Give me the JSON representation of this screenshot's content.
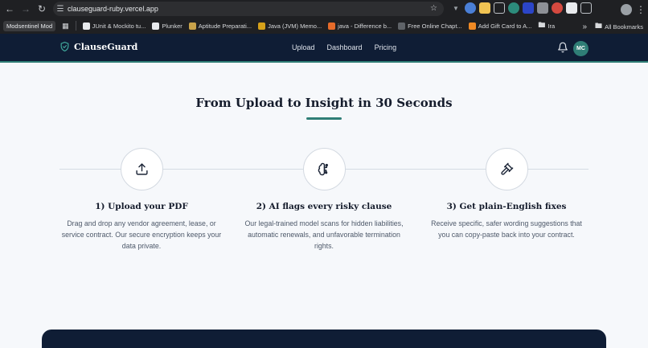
{
  "browser": {
    "url": "clauseguard-ruby.vercel.app",
    "bookmarks": [
      {
        "label": "Modsentinel Mod",
        "color": "#3a3b3e"
      },
      {
        "label": "JUnit & Mockito tu...",
        "color": "#e8eaed"
      },
      {
        "label": "Plunker",
        "color": "#e8eaed"
      },
      {
        "label": "Aptitude Preparati...",
        "color": "#c8a24a"
      },
      {
        "label": "Java (JVM) Memo...",
        "color": "#d6a11a"
      },
      {
        "label": "java - Difference b...",
        "color": "#e66b2a"
      },
      {
        "label": "Free Online Chapt...",
        "color": "#5f6368"
      },
      {
        "label": "Add Gift Card to A...",
        "color": "#f08a24"
      },
      {
        "label": "Ira",
        "color": "#9aa0a6"
      }
    ],
    "all_bookmarks": "All Bookmarks",
    "overflow": "»"
  },
  "app": {
    "brand": "ClauseGuard",
    "nav": [
      "Upload",
      "Dashboard",
      "Pricing"
    ],
    "avatar_initials": "MC",
    "accent": "#2f7e76",
    "navy": "#0f1d35"
  },
  "how_it_works": {
    "title": "From Upload to Insight in 30 Seconds",
    "steps": [
      {
        "icon": "upload-icon",
        "title": "1) Upload your PDF",
        "description": "Drag and drop any vendor agreement, lease, or service contract. Our secure encryption keeps your data private."
      },
      {
        "icon": "brain-circuit-icon",
        "title": "2) AI flags every risky clause",
        "description": "Our legal-trained model scans for hidden liabilities, automatic renewals, and unfavorable termination rights."
      },
      {
        "icon": "gavel-icon",
        "title": "3) Get plain-English fixes",
        "description": "Receive specific, safer wording suggestions that you can copy-paste back into your contract."
      }
    ]
  }
}
